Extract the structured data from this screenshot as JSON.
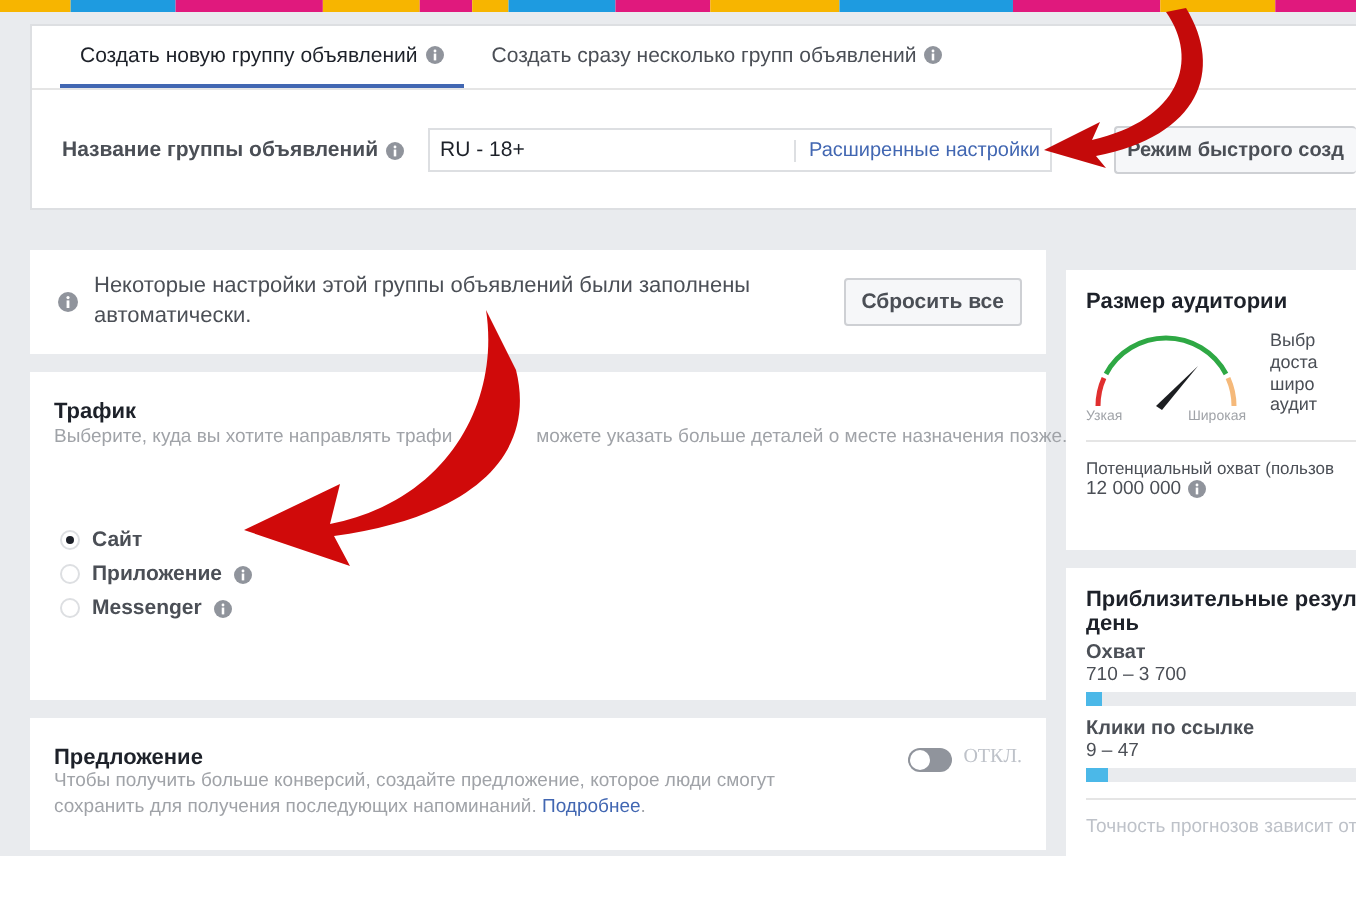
{
  "tabs": [
    {
      "label": "Создать новую группу объявлений",
      "selected": true
    },
    {
      "label": "Создать сразу несколько групп объявлений",
      "selected": false
    }
  ],
  "name_field": {
    "label": "Название группы объявлений",
    "value": "RU - 18+",
    "link": "Расширенные настройки"
  },
  "quick_button": "Режим быстрого созд",
  "notice": {
    "text": "Некоторые настройки этой группы объявлений были заполнены автоматически.",
    "button": "Сбросить все"
  },
  "traffic": {
    "title": "Трафик",
    "description_start": "Выберите, куда вы хотите направлять трафи",
    "description_end": "можете указать больше деталей о месте назначения позже.",
    "options": [
      {
        "label": "Сайт",
        "selected": true,
        "info": false
      },
      {
        "label": "Приложение",
        "selected": false,
        "info": true
      },
      {
        "label": "Messenger",
        "selected": false,
        "info": true
      }
    ]
  },
  "offer": {
    "title": "Предложение",
    "description": "Чтобы получить больше конверсий, создайте предложение, которое люди смогут сохранить для получения последующих напоминаний.",
    "link": "Подробнее",
    "after_link": ".",
    "toggle": {
      "on": false,
      "label": "ОТКЛ."
    }
  },
  "audience": {
    "title": "Размер аудитории",
    "gauge_low": "Узкая",
    "gauge_high": "Широкая",
    "side_lines": [
      "Выбр",
      "доста",
      "широ",
      "аудит"
    ],
    "reach_label": "Потенциальный охват (пользов",
    "reach_value": "12 000 000"
  },
  "results": {
    "title_line1": "Приблизительные резул",
    "title_line2": "день",
    "metrics": [
      {
        "label": "Охват",
        "range": "710 – 3 700",
        "level": 0.06
      },
      {
        "label": "Клики по ссылке",
        "range": "9 – 47",
        "level": 0.08
      }
    ],
    "note": "Точность прогнозов зависит от"
  }
}
